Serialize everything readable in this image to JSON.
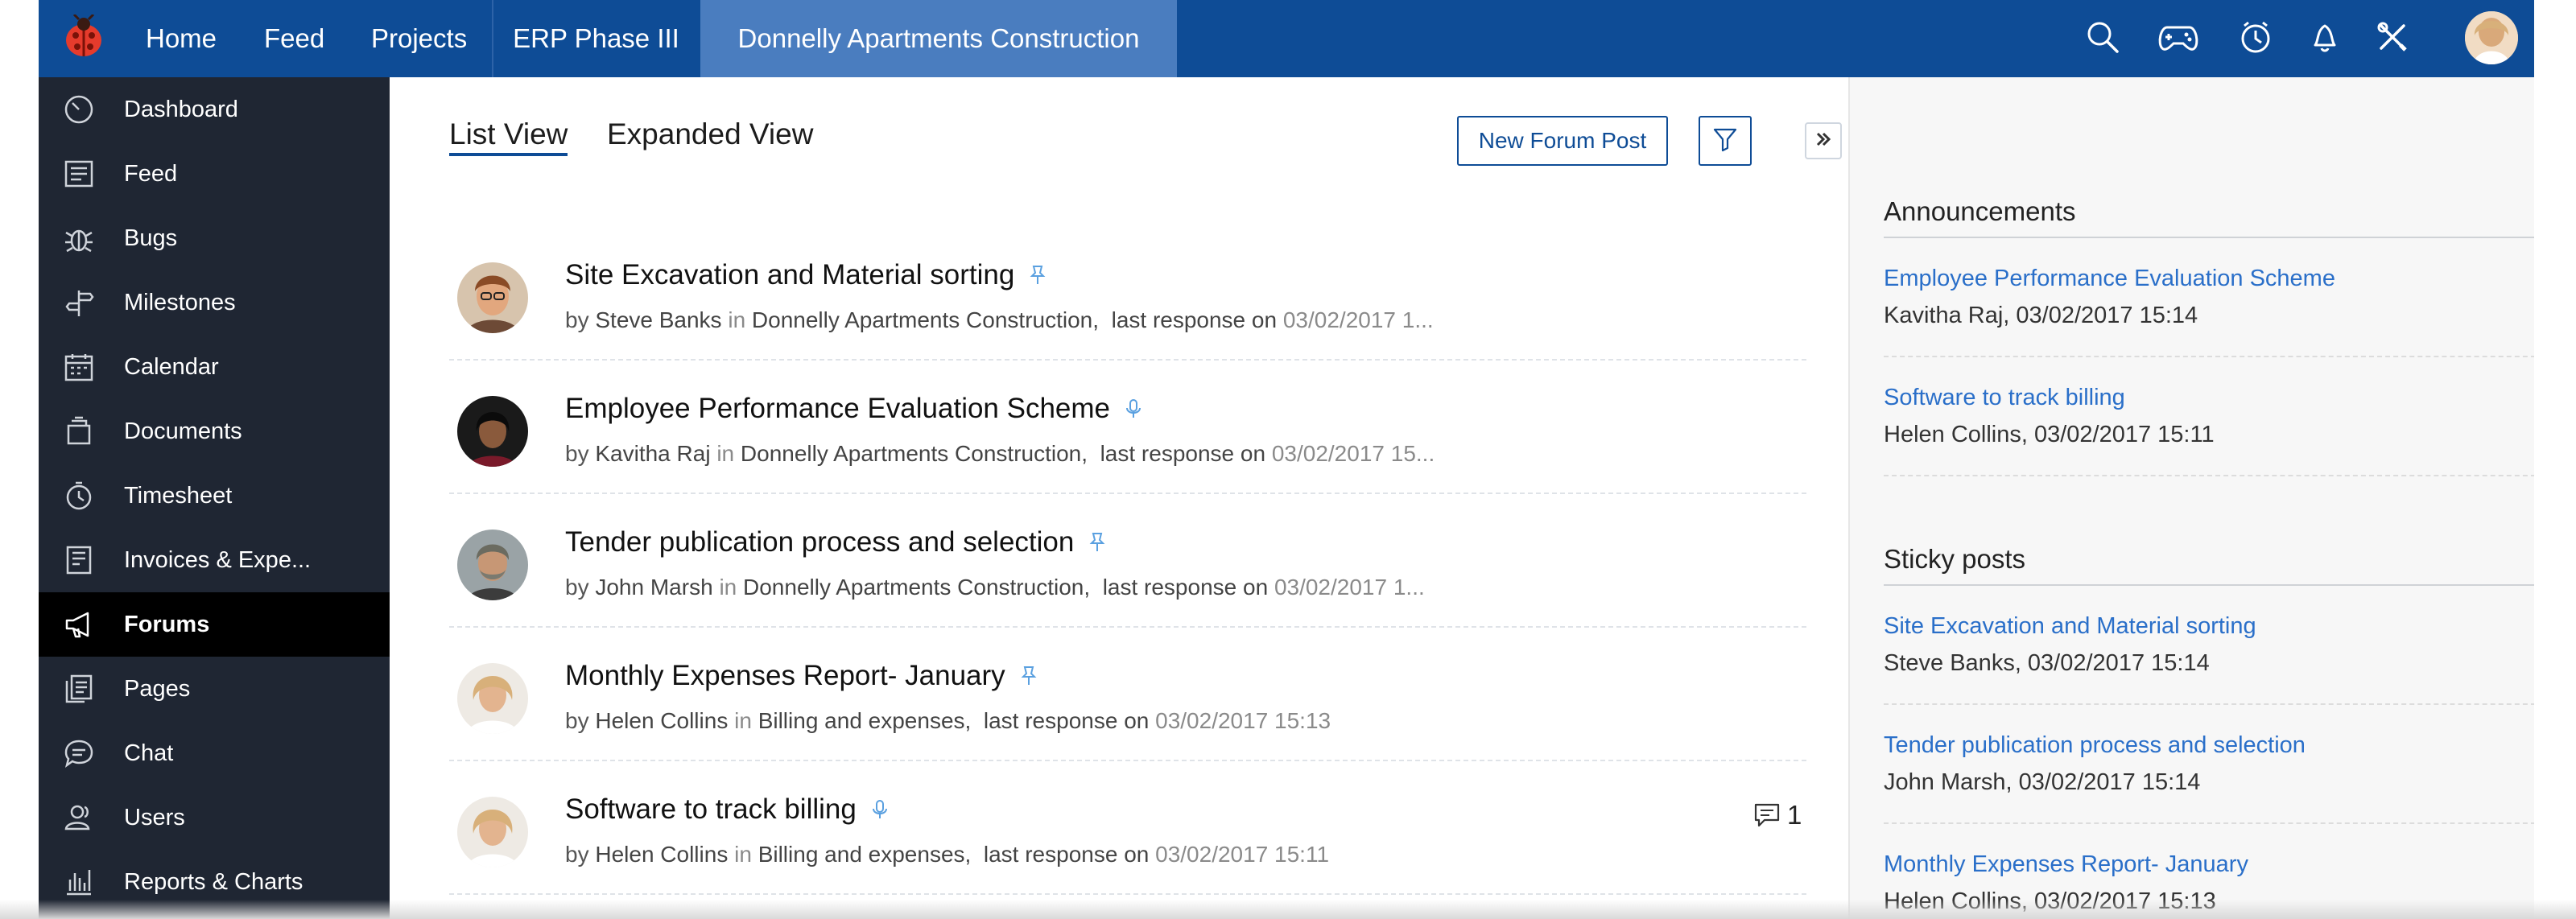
{
  "topbar": {
    "nav": [
      "Home",
      "Feed",
      "Projects",
      "ERP Phase III",
      "Donnelly Apartments Construction"
    ],
    "icons": [
      "search-icon",
      "gamepad-icon",
      "timer-icon",
      "bell-icon",
      "tools-icon"
    ],
    "accent": "#0e4c96"
  },
  "sidebar": {
    "items": [
      {
        "label": "Dashboard",
        "icon": "speedometer-icon"
      },
      {
        "label": "Feed",
        "icon": "feed-icon"
      },
      {
        "label": "Bugs",
        "icon": "bug-icon"
      },
      {
        "label": "Milestones",
        "icon": "signpost-icon"
      },
      {
        "label": "Calendar",
        "icon": "calendar-icon"
      },
      {
        "label": "Documents",
        "icon": "documents-icon"
      },
      {
        "label": "Timesheet",
        "icon": "stopwatch-icon"
      },
      {
        "label": "Invoices & Expe...",
        "icon": "invoice-icon"
      },
      {
        "label": "Forums",
        "icon": "megaphone-icon",
        "active": true
      },
      {
        "label": "Pages",
        "icon": "pages-icon"
      },
      {
        "label": "Chat",
        "icon": "chat-icon"
      },
      {
        "label": "Users",
        "icon": "users-icon"
      },
      {
        "label": "Reports & Charts",
        "icon": "reports-icon"
      }
    ]
  },
  "main": {
    "tabs": [
      "List View",
      "Expanded View"
    ],
    "new_post_label": "New Forum Post",
    "posts": [
      {
        "title": "Site Excavation and Material sorting",
        "by": "by",
        "author": "Steve Banks",
        "in": "in",
        "category": "Donnelly Apartments Construction,",
        "last": "last response on",
        "date": "03/02/2017 1...",
        "icon": "pin-icon"
      },
      {
        "title": "Employee Performance Evaluation Scheme",
        "by": "by",
        "author": "Kavitha Raj",
        "in": "in",
        "category": "Donnelly Apartments Construction,",
        "last": "last response on",
        "date": "03/02/2017 15...",
        "icon": "microphone-icon"
      },
      {
        "title": "Tender publication process and selection",
        "by": "by",
        "author": "John Marsh",
        "in": "in",
        "category": "Donnelly Apartments Construction,",
        "last": "last response on",
        "date": "03/02/2017 1...",
        "icon": "pin-icon"
      },
      {
        "title": "Monthly Expenses Report- January",
        "by": "by",
        "author": "Helen Collins",
        "in": "in",
        "category": "Billing and expenses,",
        "last": "last response on",
        "date": "03/02/2017 15:13",
        "icon": "pin-icon"
      },
      {
        "title": "Software to track billing",
        "by": "by",
        "author": "Helen Collins",
        "in": "in",
        "category": "Billing and expenses,",
        "last": "last response on",
        "date": "03/02/2017 15:11",
        "icon": "microphone-icon",
        "comments": "1"
      }
    ]
  },
  "right": {
    "announcements_title": "Announcements",
    "announcements": [
      {
        "title": "Employee Performance Evaluation Scheme",
        "meta": "Kavitha Raj,  03/02/2017 15:14"
      },
      {
        "title": "Software to track billing",
        "meta": "Helen Collins,  03/02/2017 15:11"
      }
    ],
    "sticky_title": "Sticky posts",
    "sticky": [
      {
        "title": "Site Excavation and Material sorting",
        "meta": "Steve Banks,  03/02/2017 15:14"
      },
      {
        "title": "Tender publication process and selection",
        "meta": "John Marsh,  03/02/2017 15:14"
      },
      {
        "title": "Monthly Expenses Report- January",
        "meta": "Helen Collins,  03/02/2017 15:13"
      }
    ],
    "link_color": "#2a6fc9"
  }
}
